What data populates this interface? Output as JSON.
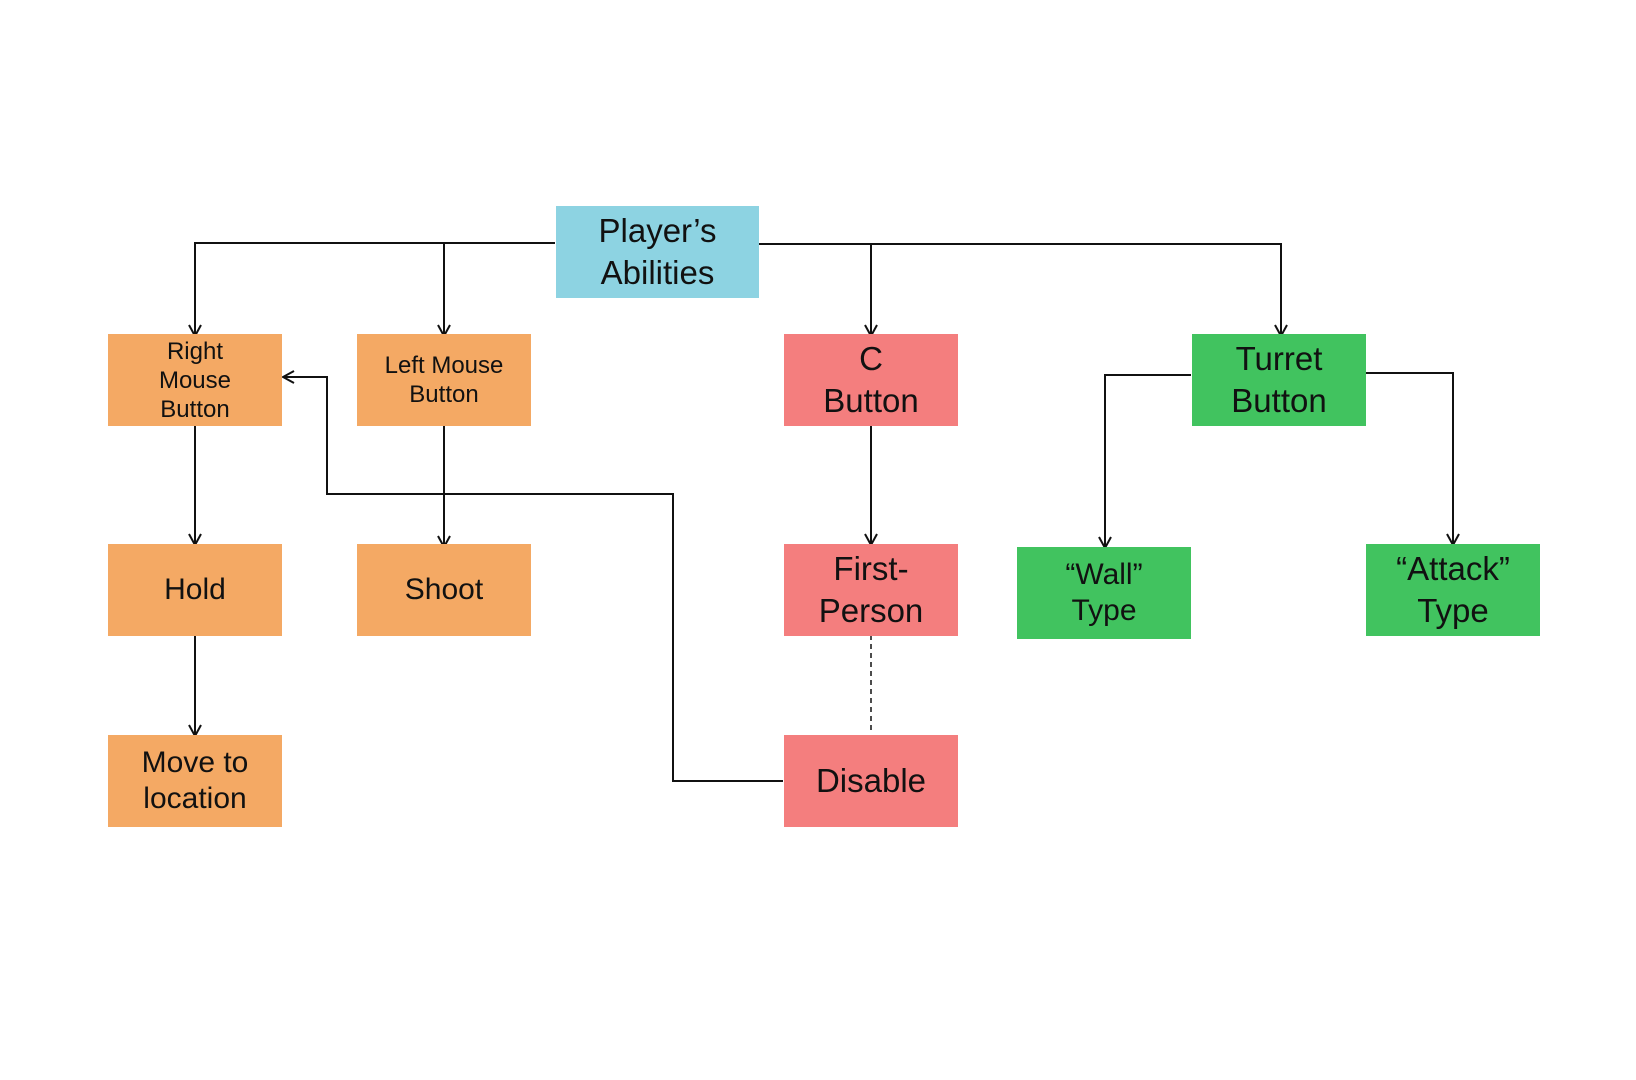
{
  "diagram": {
    "title": "Player's Abilities",
    "colors": {
      "root": "#8dd3e2",
      "mouse": "#f4a964",
      "c_button": "#f47e7e",
      "turret": "#41c35f",
      "line": "#111111"
    },
    "nodes": {
      "root": {
        "label": "Player’s\nAbilities",
        "group": "root"
      },
      "rmb": {
        "label": "Right\nMouse\nButton",
        "group": "mouse"
      },
      "lmb": {
        "label": "Left Mouse\nButton",
        "group": "mouse"
      },
      "c": {
        "label": "C\nButton",
        "group": "c_button"
      },
      "turret": {
        "label": "Turret\nButton",
        "group": "turret"
      },
      "hold": {
        "label": "Hold",
        "group": "mouse"
      },
      "shoot": {
        "label": "Shoot",
        "group": "mouse"
      },
      "firstperson": {
        "label": "First-\nPerson",
        "group": "c_button"
      },
      "wall": {
        "label": "“Wall”\nType",
        "group": "turret"
      },
      "attack": {
        "label": "“Attack”\nType",
        "group": "turret"
      },
      "move": {
        "label": "Move to\nlocation",
        "group": "mouse"
      },
      "disable": {
        "label": "Disable",
        "group": "c_button"
      }
    },
    "edges": [
      {
        "from": "root",
        "to": "rmb",
        "style": "arrow"
      },
      {
        "from": "root",
        "to": "lmb",
        "style": "arrow"
      },
      {
        "from": "root",
        "to": "c",
        "style": "arrow"
      },
      {
        "from": "root",
        "to": "turret",
        "style": "arrow"
      },
      {
        "from": "rmb",
        "to": "hold",
        "style": "arrow"
      },
      {
        "from": "lmb",
        "to": "shoot",
        "style": "arrow"
      },
      {
        "from": "c",
        "to": "firstperson",
        "style": "arrow"
      },
      {
        "from": "turret",
        "to": "wall",
        "style": "arrow"
      },
      {
        "from": "turret",
        "to": "attack",
        "style": "arrow"
      },
      {
        "from": "hold",
        "to": "move",
        "style": "arrow"
      },
      {
        "from": "firstperson",
        "to": "disable",
        "style": "dashed"
      },
      {
        "from": "disable",
        "to": "rmb",
        "style": "arrow"
      }
    ]
  }
}
